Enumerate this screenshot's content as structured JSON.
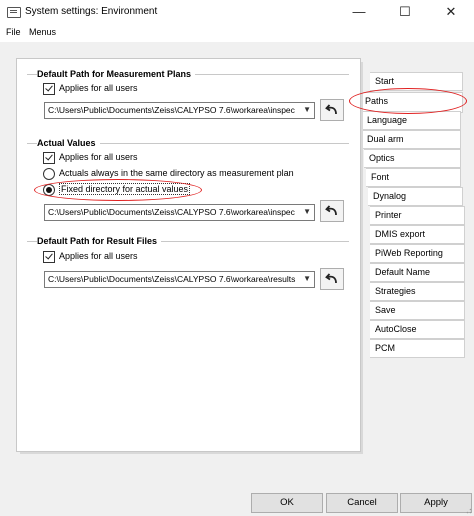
{
  "window": {
    "title": "System settings: Environment",
    "minimize": "—",
    "maximize": "☐",
    "close": "✕"
  },
  "menubar": {
    "items": [
      "File",
      "Menus"
    ]
  },
  "sections": {
    "measurement_plans": {
      "title": "Default Path for Measurement Plans",
      "applies_label": "Applies for all users",
      "path": "C:\\Users\\Public\\Documents\\Zeiss\\CALYPSO 7.6\\workarea\\inspec"
    },
    "actual_values": {
      "title": "Actual Values",
      "applies_label": "Applies for all users",
      "option_same_dir": "Actuals always in the same directory as measurement plan",
      "option_fixed_dir": "Fixed directory for actual values",
      "path": "C:\\Users\\Public\\Documents\\Zeiss\\CALYPSO 7.6\\workarea\\inspec"
    },
    "result_files": {
      "title": "Default Path for Result Files",
      "applies_label": "Applies for all users",
      "path": "C:\\Users\\Public\\Documents\\Zeiss\\CALYPSO 7.6\\workarea\\results"
    }
  },
  "tabs": [
    "Start",
    "Paths",
    "Language",
    "Dual arm",
    "Optics",
    "Font",
    "Dynalog",
    "Printer",
    "DMIS export",
    "PiWeb Reporting",
    "Default Name",
    "Strategies",
    "Save",
    "AutoClose",
    "PCM"
  ],
  "selected_tab": "Paths",
  "buttons": {
    "ok": "OK",
    "cancel": "Cancel",
    "apply": "Apply"
  },
  "colors": {
    "annotation": "#e02020",
    "window_bg": "#f0f0f0"
  }
}
